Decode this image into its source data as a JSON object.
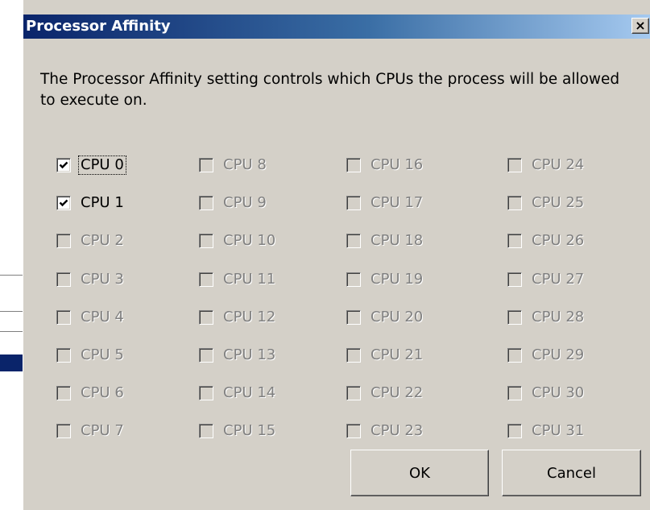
{
  "dialog": {
    "title": "Processor Affinity",
    "close_label": "×",
    "description": "The Processor Affinity setting controls which CPUs the process will be allowed to execute on.",
    "buttons": {
      "ok": "OK",
      "cancel": "Cancel"
    },
    "cpus": [
      {
        "label": "CPU 0",
        "checked": true,
        "enabled": true,
        "focused": true
      },
      {
        "label": "CPU 1",
        "checked": true,
        "enabled": true,
        "focused": false
      },
      {
        "label": "CPU 2",
        "checked": false,
        "enabled": false
      },
      {
        "label": "CPU 3",
        "checked": false,
        "enabled": false
      },
      {
        "label": "CPU 4",
        "checked": false,
        "enabled": false
      },
      {
        "label": "CPU 5",
        "checked": false,
        "enabled": false
      },
      {
        "label": "CPU 6",
        "checked": false,
        "enabled": false
      },
      {
        "label": "CPU 7",
        "checked": false,
        "enabled": false
      },
      {
        "label": "CPU 8",
        "checked": false,
        "enabled": false
      },
      {
        "label": "CPU 9",
        "checked": false,
        "enabled": false
      },
      {
        "label": "CPU 10",
        "checked": false,
        "enabled": false
      },
      {
        "label": "CPU 11",
        "checked": false,
        "enabled": false
      },
      {
        "label": "CPU 12",
        "checked": false,
        "enabled": false
      },
      {
        "label": "CPU 13",
        "checked": false,
        "enabled": false
      },
      {
        "label": "CPU 14",
        "checked": false,
        "enabled": false
      },
      {
        "label": "CPU 15",
        "checked": false,
        "enabled": false
      },
      {
        "label": "CPU 16",
        "checked": false,
        "enabled": false
      },
      {
        "label": "CPU 17",
        "checked": false,
        "enabled": false
      },
      {
        "label": "CPU 18",
        "checked": false,
        "enabled": false
      },
      {
        "label": "CPU 19",
        "checked": false,
        "enabled": false
      },
      {
        "label": "CPU 20",
        "checked": false,
        "enabled": false
      },
      {
        "label": "CPU 21",
        "checked": false,
        "enabled": false
      },
      {
        "label": "CPU 22",
        "checked": false,
        "enabled": false
      },
      {
        "label": "CPU 23",
        "checked": false,
        "enabled": false
      },
      {
        "label": "CPU 24",
        "checked": false,
        "enabled": false
      },
      {
        "label": "CPU 25",
        "checked": false,
        "enabled": false
      },
      {
        "label": "CPU 26",
        "checked": false,
        "enabled": false
      },
      {
        "label": "CPU 27",
        "checked": false,
        "enabled": false
      },
      {
        "label": "CPU 28",
        "checked": false,
        "enabled": false
      },
      {
        "label": "CPU 29",
        "checked": false,
        "enabled": false
      },
      {
        "label": "CPU 30",
        "checked": false,
        "enabled": false
      },
      {
        "label": "CPU 31",
        "checked": false,
        "enabled": false
      }
    ]
  },
  "colors": {
    "title_gradient_start": "#0a246a",
    "title_gradient_end": "#a6caf0",
    "dialog_face": "#d4d0c8",
    "disabled_text": "#808080"
  }
}
